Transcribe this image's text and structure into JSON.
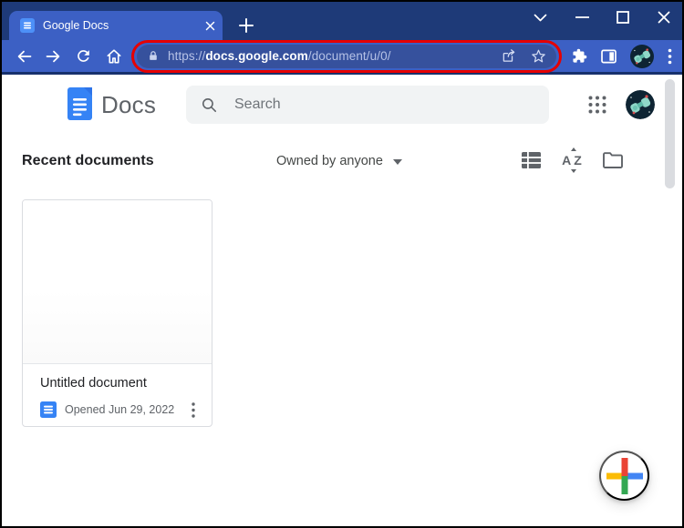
{
  "browser": {
    "tab_title": "Google Docs",
    "url_scheme": "https://",
    "url_host": "docs.google.com",
    "url_path": "/document/u/0/"
  },
  "docs_header": {
    "logo_label": "Docs",
    "search_placeholder": "Search"
  },
  "main": {
    "section_title": "Recent documents",
    "owner_filter": "Owned by anyone",
    "sort_icon_letters": {
      "a": "A",
      "z": "Z"
    },
    "documents": [
      {
        "title": "Untitled document",
        "opened": "Opened Jun 29, 2022"
      }
    ]
  },
  "colors": {
    "titlebar_blue": "#1e3a78",
    "toolbar_blue": "#3c60c4",
    "address_bar_blue": "#36519d",
    "annotation_red": "#e60000",
    "docs_blue": "#3583f5",
    "text_gray": "#5f6368",
    "text_dark": "#202124",
    "search_bg": "#f1f3f4",
    "fab_red": "#EA4335",
    "fab_yellow": "#FBBC04",
    "fab_green": "#34A853",
    "fab_blue": "#4285F4"
  }
}
